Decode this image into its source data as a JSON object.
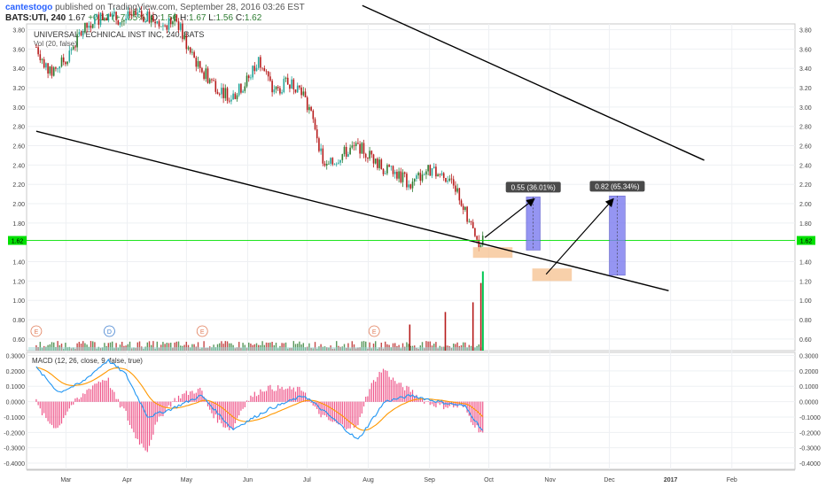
{
  "header": {
    "user": "cantestogo",
    "published": "published on TradingView.com, September 28, 2016 03:26 EST",
    "symbol": "BATS:UTI, 240",
    "last": "1.67",
    "change": "+0.11 (+7.05%)",
    "o_label": "O:",
    "o": "1.56",
    "h_label": "H:",
    "h": "1.67",
    "l_label": "L:",
    "l": "1.56",
    "c_label": "C:",
    "c": "1.62"
  },
  "chart_data": {
    "type": "candlestick",
    "title": "UNIVERSAL TECHNICAL INST INC, 240, BATS",
    "volume_label": "Vol (20, false)",
    "macd_label": "MACD (12, 26, close, 9, false, true)",
    "x_ticks": [
      "Mar",
      "Apr",
      "May",
      "Jun",
      "Jul",
      "Aug",
      "Sep",
      "Oct",
      "Nov",
      "Dec",
      "2017",
      "Feb"
    ],
    "price_axis": {
      "ticks": [
        "3.80",
        "3.60",
        "3.40",
        "3.20",
        "3.00",
        "2.80",
        "2.60",
        "2.40",
        "2.20",
        "2.00",
        "1.80",
        "1.40",
        "1.20",
        "1.00",
        "0.80",
        "0.60"
      ],
      "ylim": [
        0.48,
        3.86
      ]
    },
    "macd_axis": {
      "ticks": [
        "0.3000",
        "0.2000",
        "0.1000",
        "0.0000",
        "-0.1000",
        "-0.2000",
        "-0.3000",
        "-0.4000"
      ],
      "ylim": [
        -0.44,
        0.32
      ]
    },
    "current_price": "1.62",
    "price_path": [
      [
        "2016-02-15",
        3.62
      ],
      [
        "2016-02-22",
        3.35
      ],
      [
        "2016-03-01",
        3.5
      ],
      [
        "2016-03-08",
        3.75
      ],
      [
        "2016-03-15",
        3.9
      ],
      [
        "2016-03-22",
        3.95
      ],
      [
        "2016-03-29",
        3.9
      ],
      [
        "2016-04-05",
        3.95
      ],
      [
        "2016-04-12",
        3.92
      ],
      [
        "2016-04-19",
        3.85
      ],
      [
        "2016-04-26",
        3.9
      ],
      [
        "2016-05-03",
        3.55
      ],
      [
        "2016-05-10",
        3.35
      ],
      [
        "2016-05-17",
        3.2
      ],
      [
        "2016-05-24",
        3.1
      ],
      [
        "2016-05-31",
        3.25
      ],
      [
        "2016-06-07",
        3.5
      ],
      [
        "2016-06-14",
        3.15
      ],
      [
        "2016-06-21",
        3.25
      ],
      [
        "2016-06-28",
        3.2
      ],
      [
        "2016-07-05",
        2.8
      ],
      [
        "2016-07-10",
        2.35
      ],
      [
        "2016-07-18",
        2.5
      ],
      [
        "2016-07-26",
        2.6
      ],
      [
        "2016-08-02",
        2.5
      ],
      [
        "2016-08-09",
        2.35
      ],
      [
        "2016-08-16",
        2.3
      ],
      [
        "2016-08-23",
        2.2
      ],
      [
        "2016-08-30",
        2.35
      ],
      [
        "2016-09-06",
        2.3
      ],
      [
        "2016-09-13",
        2.25
      ],
      [
        "2016-09-20",
        1.85
      ],
      [
        "2016-09-26",
        1.55
      ],
      [
        "2016-09-28",
        1.62
      ]
    ],
    "volume_spikes": [
      [
        "2016-08-22",
        0.27
      ],
      [
        "2016-09-09",
        0.4
      ],
      [
        "2016-09-23",
        0.5
      ],
      [
        "2016-09-27",
        0.7
      ]
    ],
    "trendlines": [
      {
        "from": [
          "2016-02-15",
          2.75
        ],
        "to": [
          "2016-12-31",
          1.1
        ]
      },
      {
        "from": [
          "2016-07-29",
          4.05
        ],
        "to": [
          "2017-01-18",
          2.45
        ]
      }
    ],
    "measure_boxes": [
      {
        "label": "0.55 (36.01%)",
        "from": [
          "2016-10-20",
          1.52
        ],
        "to": [
          "2016-10-27",
          2.07
        ]
      },
      {
        "label": "0.82 (65.34%)",
        "from": [
          "2016-12-01",
          1.26
        ],
        "to": [
          "2016-12-09",
          2.08
        ]
      }
    ],
    "arrows": [
      {
        "from": [
          "2016-09-29",
          1.65
        ],
        "to": [
          "2016-10-24",
          2.05
        ]
      },
      {
        "from": [
          "2016-10-30",
          1.27
        ],
        "to": [
          "2016-12-03",
          2.05
        ]
      }
    ],
    "zones": [
      {
        "from": [
          "2016-09-23",
          1.55
        ],
        "to": [
          "2016-10-13",
          1.44
        ]
      },
      {
        "from": [
          "2016-10-23",
          1.33
        ],
        "to": [
          "2016-11-12",
          1.2
        ]
      }
    ],
    "event_markers": [
      {
        "label": "E",
        "date": "2016-02-15"
      },
      {
        "label": "D",
        "date": "2016-03-23"
      },
      {
        "label": "E",
        "date": "2016-05-09"
      },
      {
        "label": "E",
        "date": "2016-08-04"
      }
    ],
    "grid": true,
    "colors": {
      "up": "#26a69a",
      "down": "#b71c1c",
      "green_candle": "#2e7d32",
      "macd": "#2196f3",
      "signal": "#ff9800",
      "histogram": "#e91e63",
      "box": "#7b7bf0",
      "zone": "#f6c08e",
      "price_line": "#00e000"
    }
  }
}
